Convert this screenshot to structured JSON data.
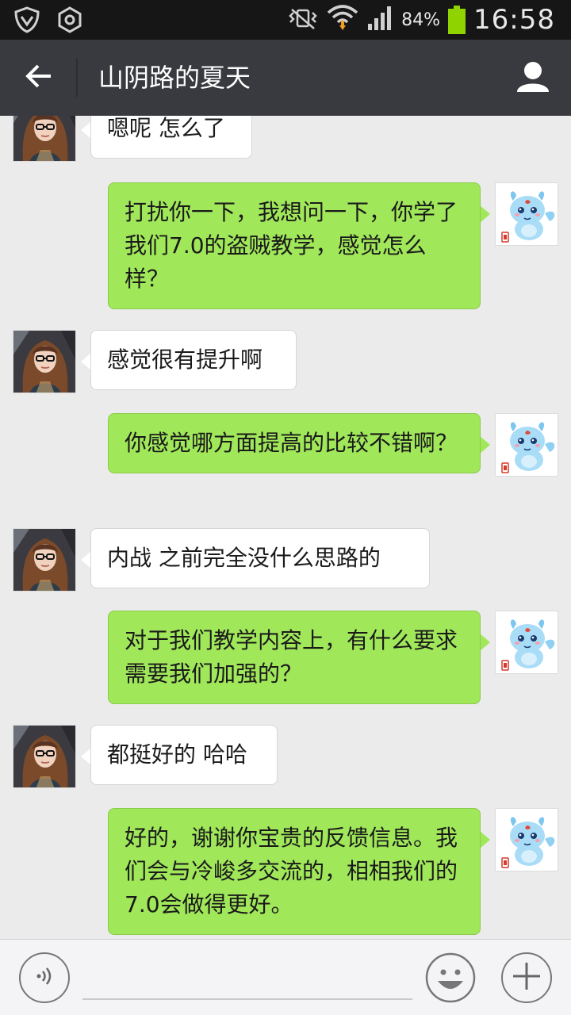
{
  "status_bar": {
    "battery_percent": "84%",
    "time": "16:58",
    "icons": [
      "shield-icon",
      "settings-hex-icon",
      "vibrate-icon",
      "wifi-icon",
      "signal-icon",
      "battery-icon"
    ]
  },
  "header": {
    "title": "山阴路的夏天",
    "back_icon": "back-arrow-icon",
    "profile_icon": "profile-icon"
  },
  "messages": [
    {
      "side": "in",
      "text": "嗯呢 怎么了"
    },
    {
      "side": "out",
      "text": "打扰你一下，我想问一下，你学了我们7.0的盗贼教学，感觉怎么样？"
    },
    {
      "side": "in",
      "text": "感觉很有提升啊"
    },
    {
      "side": "out",
      "text": "你感觉哪方面提高的比较不错啊？"
    },
    {
      "side": "in",
      "text": "内战 之前完全没什么思路的"
    },
    {
      "side": "out",
      "text": "对于我们教学内容上，有什么要求需要我们加强的？"
    },
    {
      "side": "in",
      "text": "都挺好的 哈哈"
    },
    {
      "side": "out",
      "text": "好的，谢谢你宝贵的反馈信息。我们会与冷峻多交流的，相相我们的7.0会做得更好。"
    }
  ],
  "input_bar": {
    "placeholder": "",
    "voice_icon": "voice-icon",
    "emoji_icon": "emoji-icon",
    "plus_icon": "plus-icon"
  },
  "colors": {
    "header_bg": "#393a3f",
    "outgoing_bubble": "#a0e75a",
    "incoming_bubble": "#ffffff",
    "chat_bg": "#ebebeb"
  }
}
